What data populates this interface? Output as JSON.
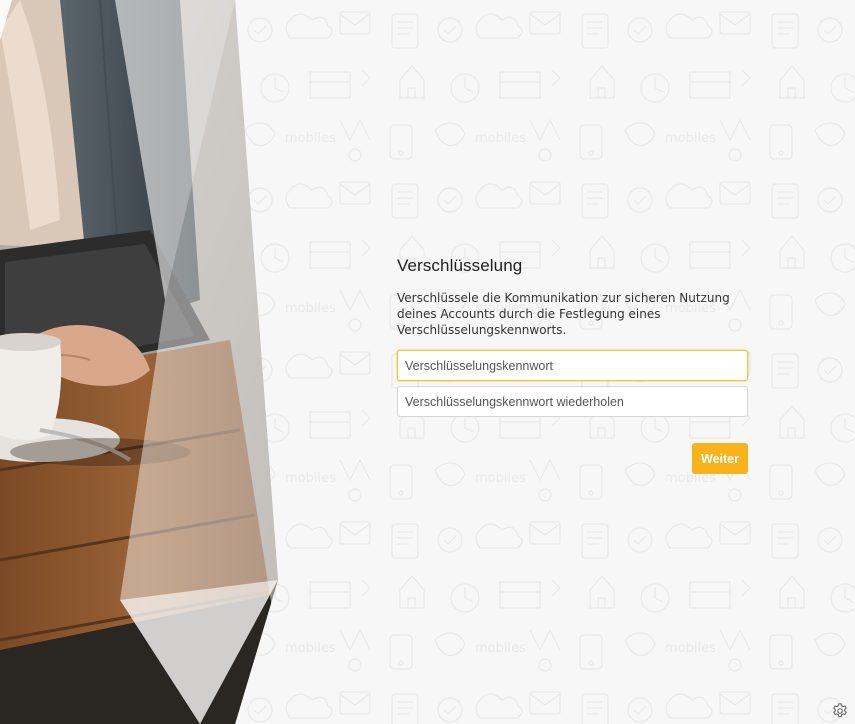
{
  "form": {
    "title": "Verschlüsselung",
    "description": "Verschlüssele die Kommunikation zur sicheren Nutzung deines Accounts durch die Festlegung eines Verschlüsselungskennworts.",
    "password": {
      "value": "",
      "placeholder": "Verschlüsselungskennwort"
    },
    "password_repeat": {
      "value": "",
      "placeholder": "Verschlüsselungskennwort wiederholen"
    },
    "next_label": "Weiter"
  },
  "icons": {
    "settings": "gear-icon"
  },
  "colors": {
    "accent": "#f8b31c",
    "focus_border": "#f5c333",
    "text": "#333333",
    "background": "#f7f7f7"
  }
}
